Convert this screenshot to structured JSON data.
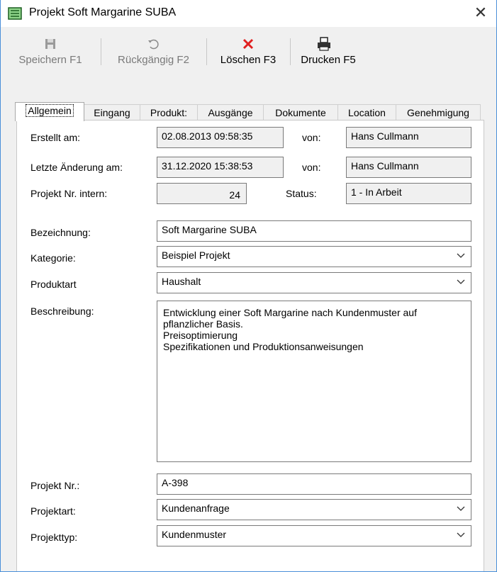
{
  "window": {
    "title": "Projekt Soft Margarine SUBA",
    "close_glyph": "✕",
    "app_icon": "form-icon"
  },
  "toolbar": {
    "save_label": "Speichern F1",
    "undo_label": "Rückgängig F2",
    "delete_label": "Löschen F3",
    "print_label": "Drucken F5"
  },
  "tabs": [
    {
      "label": "Allgemein"
    },
    {
      "label": "Eingang"
    },
    {
      "label": "Produkt:"
    },
    {
      "label": "Ausgänge"
    },
    {
      "label": "Dokumente"
    },
    {
      "label": "Location"
    },
    {
      "label": "Genehmigung"
    }
  ],
  "general": {
    "created_label": "Erstellt am:",
    "created_value": "02.08.2013 09:58:35",
    "created_by_label": "von:",
    "created_by_value": "Hans Cullmann",
    "changed_label": "Letzte Änderung am:",
    "changed_value": "31.12.2020 15:38:53",
    "changed_by_label": "von:",
    "changed_by_value": "Hans Cullmann",
    "internal_no_label": "Projekt Nr. intern:",
    "internal_no_value": "24",
    "status_label": "Status:",
    "status_value": "1 - In Arbeit",
    "designation_label": "Bezeichnung:",
    "designation_value": "Soft Margarine SUBA",
    "category_label": "Kategorie:",
    "category_value": "Beispiel Projekt",
    "product_type_label": "Produktart",
    "product_type_value": "Haushalt",
    "description_label": "Beschreibung:",
    "description_lines": [
      "Entwicklung einer Soft Margarine nach Kundenmuster auf",
      "pflanzlicher Basis.",
      "Preisoptimierung",
      "Spezifikationen und Produktionsanweisungen"
    ],
    "project_no_label": "Projekt Nr.:",
    "project_no_value": "A-398",
    "project_kind_label": "Projektart:",
    "project_kind_value": "Kundenanfrage",
    "project_type_label": "Projekttyp:",
    "project_type_value": "Kundenmuster"
  }
}
